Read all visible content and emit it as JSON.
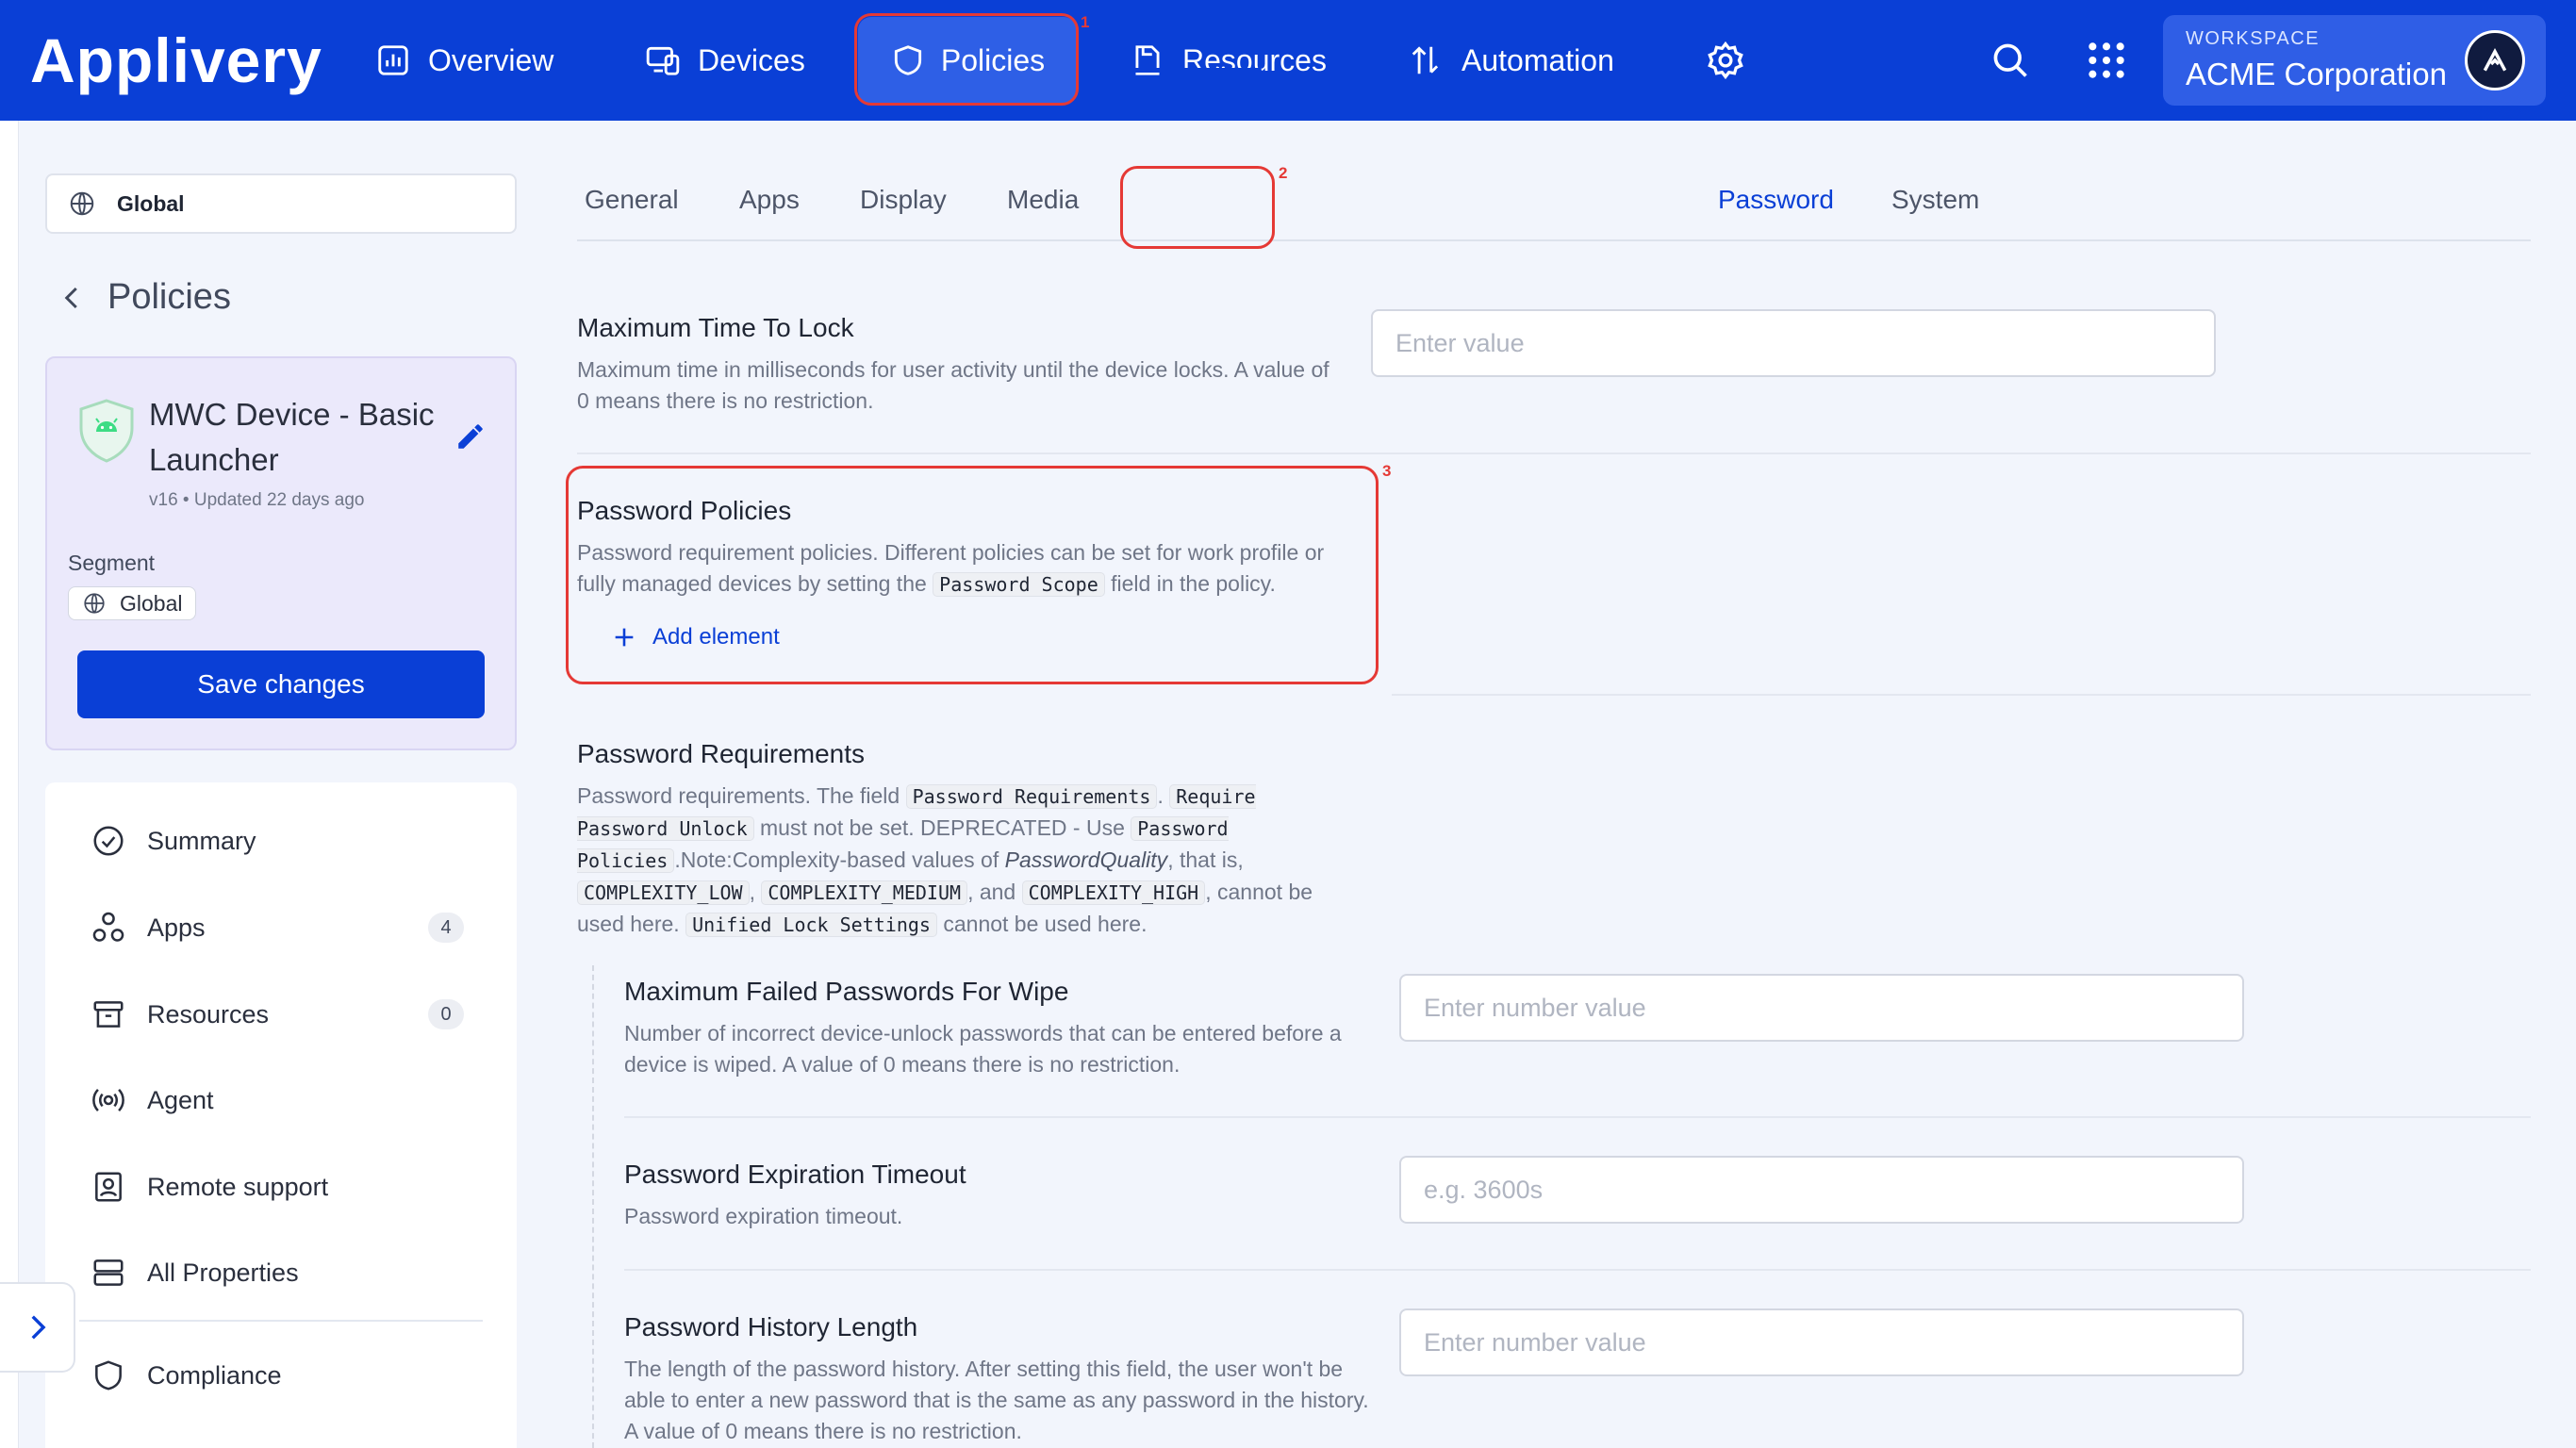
{
  "topbar": {
    "logo": "Applivery",
    "nav": [
      {
        "label": "Overview",
        "icon": "overview-chart-icon"
      },
      {
        "label": "Devices",
        "icon": "devices-icon"
      },
      {
        "label": "Policies",
        "icon": "shield-icon"
      },
      {
        "label": "Resources",
        "icon": "resources-icon"
      },
      {
        "label": "Automation",
        "icon": "automation-icon"
      }
    ],
    "workspace_label": "WORKSPACE",
    "workspace_name": "ACME Corporation",
    "annotations": [
      "1",
      "2",
      "3"
    ]
  },
  "sidebar": {
    "segment_select": "Global",
    "back_label": "Policies",
    "policy": {
      "name": "MWC Device - Basic Launcher",
      "meta": "v16 • Updated 22 days ago",
      "segment_label": "Segment",
      "segment_value": "Global",
      "save_label": "Save changes"
    },
    "menu": [
      {
        "label": "Summary",
        "icon": "check-circle-icon",
        "badge": ""
      },
      {
        "label": "Apps",
        "icon": "apps-icon",
        "badge": "4"
      },
      {
        "label": "Resources",
        "icon": "archive-icon",
        "badge": "0"
      },
      {
        "label": "Agent",
        "icon": "broadcast-icon",
        "badge": ""
      },
      {
        "label": "Remote support",
        "icon": "remote-support-icon",
        "badge": ""
      },
      {
        "label": "All Properties",
        "icon": "list-icon",
        "badge": ""
      },
      {
        "label": "Compliance",
        "icon": "shield-icon",
        "badge": ""
      }
    ]
  },
  "tabs": [
    "General",
    "Apps",
    "Display",
    "Media",
    "Password",
    "System"
  ],
  "active_tab": "Password",
  "fields": {
    "max_time_lock": {
      "title": "Maximum Time To Lock",
      "desc": "Maximum time in milliseconds for user activity until the device locks. A value of 0 means there is no restriction.",
      "placeholder": "Enter value"
    },
    "password_policies": {
      "title": "Password Policies",
      "desc_a": "Password requirement policies. Different policies can be set for work profile or fully managed devices by setting the",
      "code_a": "Password Scope",
      "desc_b": "field in the policy.",
      "add_label": "Add element"
    },
    "password_requirements": {
      "title": "Password Requirements",
      "t1": "Password requirements. The field",
      "c1": "Password Requirements",
      "t2": ".",
      "c2": "Require Password Unlock",
      "t3": "must not be set. DEPRECATED - Use",
      "c3": "Password Policies",
      "t4": ".Note:Complexity-based values of",
      "em1": "PasswordQuality",
      "t5": ", that is,",
      "c4": "COMPLEXITY_LOW",
      "t6": ",",
      "c5": "COMPLEXITY_MEDIUM",
      "t7": ", and",
      "c6": "COMPLEXITY_HIGH",
      "t8": ", cannot be used here.",
      "c7": "Unified Lock Settings",
      "t9": "cannot be used here."
    },
    "max_failed": {
      "title": "Maximum Failed Passwords For Wipe",
      "desc": "Number of incorrect device-unlock passwords that can be entered before a device is wiped. A value of 0 means there is no restriction.",
      "placeholder": "Enter number value"
    },
    "expiration": {
      "title": "Password Expiration Timeout",
      "desc": "Password expiration timeout.",
      "placeholder": "e.g. 3600s"
    },
    "history": {
      "title": "Password History Length",
      "desc": "The length of the password history. After setting this field, the user won't be able to enter a new password that is the same as any password in the history. A value of 0 means there is no restriction.",
      "placeholder": "Enter number value"
    }
  }
}
